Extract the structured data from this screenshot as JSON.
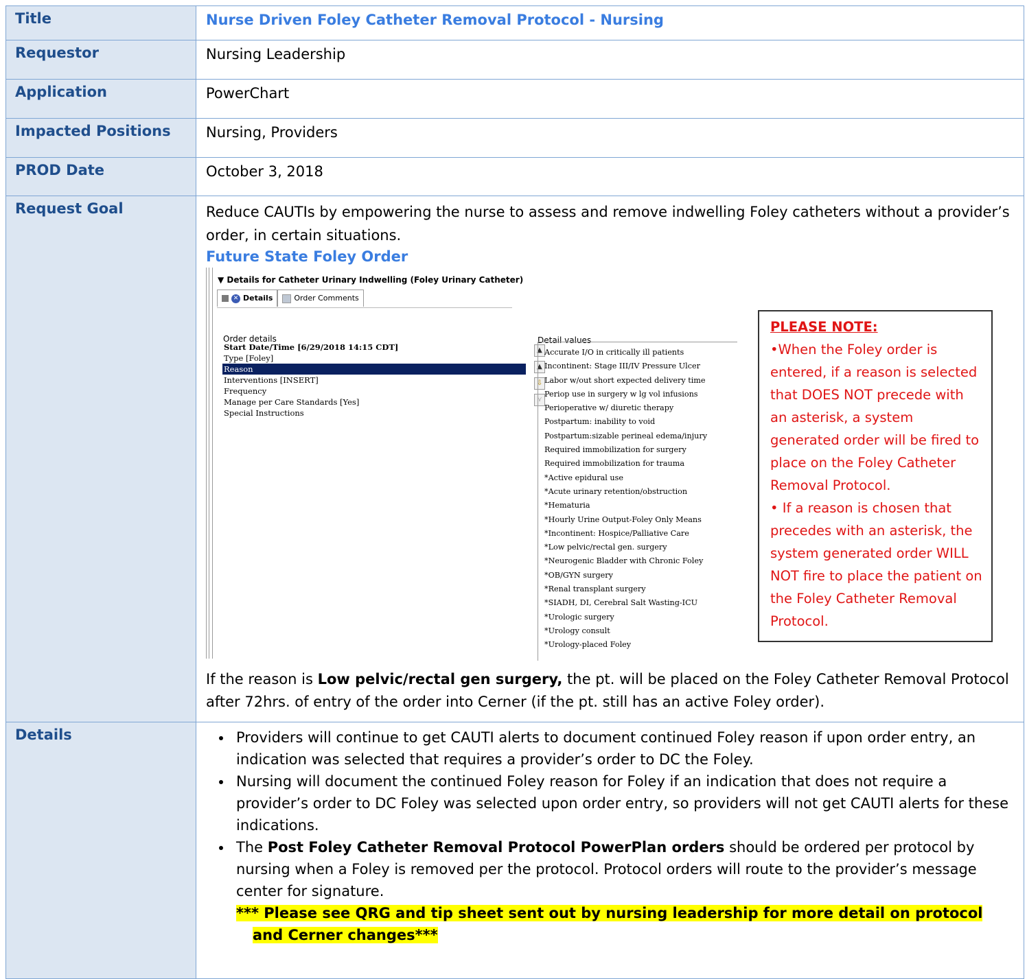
{
  "rows": {
    "title": {
      "label": "Title",
      "value": "Nurse Driven Foley Catheter Removal Protocol - Nursing"
    },
    "requestor": {
      "label": "Requestor",
      "value": "Nursing Leadership"
    },
    "application": {
      "label": "Application",
      "value": "PowerChart"
    },
    "impacted": {
      "label": "Impacted Positions",
      "value": "Nursing, Providers"
    },
    "prod_date": {
      "label": "PROD Date",
      "value": "October 3, 2018"
    },
    "goal": {
      "label": "Request Goal",
      "text": "Reduce CAUTIs by empowering the nurse to assess and remove indwelling Foley catheters without a provider’s order, in certain situations.",
      "subhead": "Future State Foley Order",
      "after_pre": "If the reason is ",
      "after_bold": "Low pelvic/rectal gen surgery,",
      "after_post": " the pt. will be placed on the Foley Catheter Removal Protocol after 72hrs. of entry of the order into Cerner (if the pt. still has an active Foley order)."
    },
    "details": {
      "label": "Details",
      "bullet1": "Providers will continue to get CAUTI alerts to document continued Foley reason if upon order entry, an indication was selected that requires a provider’s order to DC the Foley.",
      "bullet2": "Nursing will document the continued Foley reason for Foley if an indication that does not require a provider’s order to DC Foley was selected upon order entry, so providers will not get CAUTI alerts for these indications.",
      "bullet3_pre": "The ",
      "bullet3_bold": "Post Foley Catheter Removal Protocol PowerPlan orders",
      "bullet3_post": " should be ordered per protocol by nursing when a Foley is removed per the protocol.  Protocol orders will route to the provider’s message center for signature.",
      "highlight": "*** Please see QRG and tip sheet sent out by nursing leadership for more detail on protocol and Cerner changes***"
    }
  },
  "screenshot": {
    "title": "Details for Catheter Urinary Indwelling (Foley Urinary Catheter)",
    "tab_details": "Details",
    "tab_comments": "Order Comments",
    "order_details_label": "Order details",
    "detail_values_label": "Detail values",
    "order_details": [
      "Start Date/Time  [6/29/2018 14:15 CDT]",
      "Type  [Foley]",
      "Reason",
      "Interventions  [INSERT]",
      "Frequency",
      "Manage per Care Standards  [Yes]",
      "Special Instructions"
    ],
    "detail_values": [
      "Accurate I/O in critically ill patients",
      "Incontinent: Stage III/IV Pressure Ulcer",
      "Labor w/out short expected delivery time",
      "Periop use in surgery w lg vol infusions",
      "Perioperative w/ diuretic therapy",
      "Postpartum: inability to void",
      "Postpartum:sizable perineal edema/injury",
      "Required immobilization for surgery",
      "Required immobilization for trauma",
      "*Active epidural use",
      "*Acute urinary retention/obstruction",
      "*Hematuria",
      "*Hourly Urine Output-Foley Only Means",
      "*Incontinent: Hospice/Palliative Care",
      "*Low pelvic/rectal gen. surgery",
      "*Neurogenic Bladder with Chronic Foley",
      "*OB/GYN surgery",
      "*Renal transplant surgery",
      "*SIADH, DI, Cerebral Salt Wasting-ICU",
      "*Urologic surgery",
      "*Urology consult",
      "*Urology-placed Foley"
    ],
    "note": {
      "heading": "PLEASE NOTE:",
      "p1": "•When the Foley order is entered, if a reason is selected that DOES NOT precede with an asterisk, a system generated order will be fired to place on the Foley Catheter Removal Protocol.",
      "p2": "• If a reason is chosen that precedes with an asterisk, the system generated order WILL NOT fire to place the patient on the Foley Catheter Removal Protocol."
    }
  }
}
